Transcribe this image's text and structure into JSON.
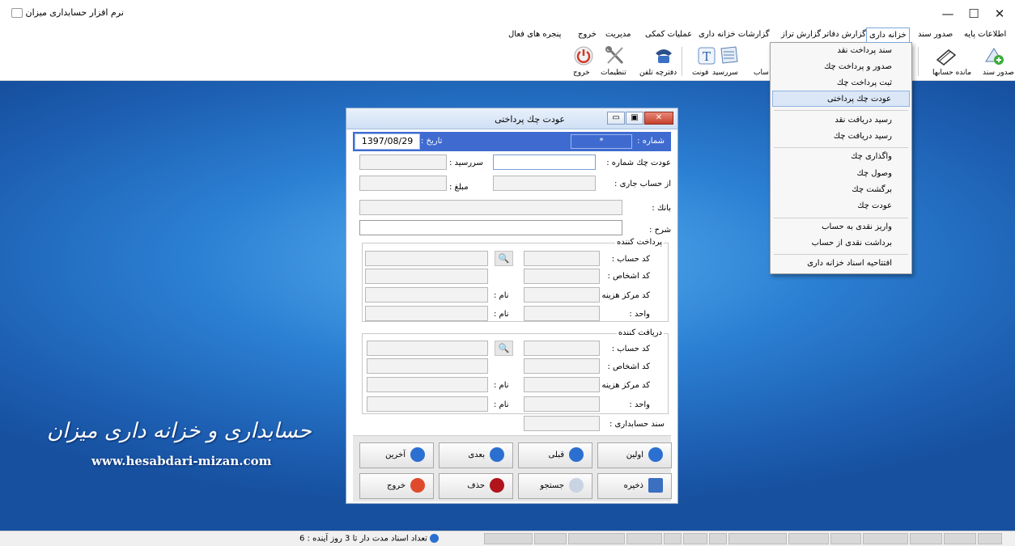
{
  "window": {
    "title": "نرم افزار حسابداری میزان",
    "controls": {
      "minimize": "—",
      "maximize": "☐",
      "close": "✕"
    }
  },
  "menubar": {
    "items": [
      {
        "label": "اطلاعات پایه"
      },
      {
        "label": "صدور سند"
      },
      {
        "label": "خزانه داری"
      },
      {
        "label": "گزارش دفاتر"
      },
      {
        "label": "گزارش تراز"
      },
      {
        "label": "گزارشات خزانه داری"
      },
      {
        "label": "عملیات کمکی"
      },
      {
        "label": "مدیریت"
      },
      {
        "label": "خروج"
      },
      {
        "label": "پنجره های فعال"
      }
    ]
  },
  "toolbar": {
    "items": [
      {
        "label": "صدور سند",
        "icon": "add-document-icon"
      },
      {
        "label": "مانده حسابها",
        "icon": "notebook-icon"
      },
      {
        "label": "ساب",
        "icon": "account-icon"
      },
      {
        "label": "سررسید",
        "icon": "calendar-icon"
      },
      {
        "label": "فونت",
        "icon": "font-icon"
      },
      {
        "label": "دفترچه تلفن",
        "icon": "phone-icon"
      },
      {
        "label": "تنظیمات",
        "icon": "tools-icon"
      },
      {
        "label": "خروج",
        "icon": "power-icon"
      }
    ]
  },
  "dropdown": {
    "items": [
      {
        "label": "سند پرداخت نقد"
      },
      {
        "label": "صدور و پرداخت چك"
      },
      {
        "label": "ثبت پرداخت چك"
      },
      {
        "label": "عودت چك پرداختی",
        "highlighted": true
      },
      {
        "label": "رسید دریافت نقد"
      },
      {
        "label": "رسید دریافت چك"
      },
      {
        "label": "واگذاری چك"
      },
      {
        "label": "وصول چك"
      },
      {
        "label": "برگشت چك"
      },
      {
        "label": "عودت چك"
      },
      {
        "label": "واریز نقدی به حساب"
      },
      {
        "label": "برداشت نقدی از حساب"
      },
      {
        "label": "افتتاحیه اسناد خزانه داری"
      }
    ]
  },
  "dialog": {
    "title": "عودت چك پرداختی",
    "number_label": "شماره :",
    "number_value": "*",
    "date_label": "تاریخ :",
    "date_value": "1397/08/29",
    "check_number_label": "عودت چك شماره :",
    "due_label": "سررسید :",
    "from_account_label": "از حساب جاری :",
    "amount_label": "مبلغ :",
    "bank_label": "بانك :",
    "description_label": "شرح :",
    "payer": {
      "title": "پرداخت كننده",
      "account_code": "كد حساب :",
      "person_code": "كد اشخاص :",
      "cost_center": "كد مركز هزینه :",
      "unit": "واحد :",
      "name1": "نام :",
      "name2": "نام :"
    },
    "receiver": {
      "title": "دریافت كننده",
      "account_code": "كد حساب :",
      "person_code": "كد اشخاص :",
      "cost_center": "كد مركز هزینه :",
      "unit": "واحد :",
      "name1": "نام :",
      "name2": "نام :"
    },
    "accounting_doc_label": "سند حسابداری :",
    "buttons": {
      "first": "اولین",
      "prev": "قبلی",
      "next": "بعدی",
      "last": "آخرین",
      "save": "ذخیره",
      "search": "جستجو",
      "delete": "حذف",
      "exit": "خروج"
    },
    "controls": {
      "close": "✕",
      "restore": "▣",
      "minimize": "▭"
    }
  },
  "desktop": {
    "brand": "حسابداری و خزانه داری میزان",
    "url": "www.hesabdari-mizan.com"
  },
  "statusbar": {
    "text": "تعداد اسناد مدت دار تا 3 روز آینده : 6"
  },
  "colors": {
    "accent": "#3f6bd0",
    "desktop": "#2b7fd3",
    "highlight": "#dbe7f7"
  }
}
